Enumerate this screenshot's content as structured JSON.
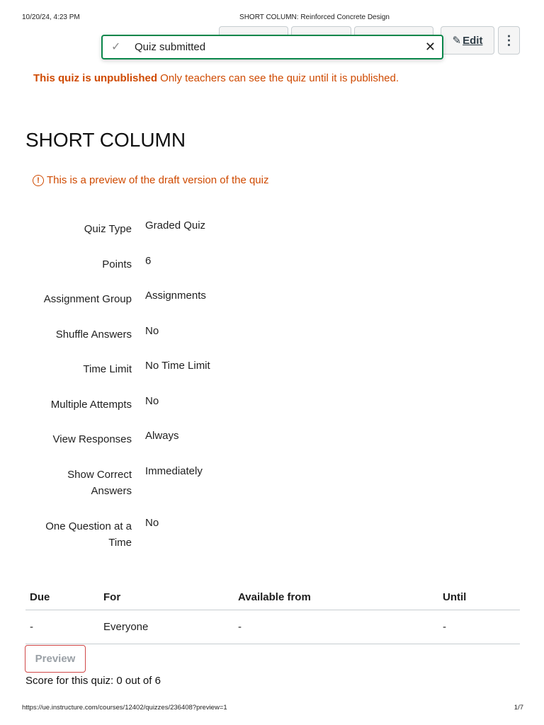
{
  "print_header": {
    "datetime": "10/20/24, 4:23 PM",
    "doc_title": "SHORT COLUMN: Reinforced Concrete Design"
  },
  "toolbar": {
    "edit_label": "Edit",
    "edit_icon": "pencil-icon",
    "more_icon": "kebab-icon"
  },
  "toast": {
    "message": "Quiz submitted",
    "icon": "check-icon",
    "close_icon": "close-icon",
    "border_color": "#0b874b"
  },
  "unpublished": {
    "bold": "This quiz is unpublished",
    "text": " Only teachers can see the quiz until it is published.",
    "color": "#cf4a00"
  },
  "quiz": {
    "title": "SHORT COLUMN",
    "draft_note": "This is a preview of the draft version of the quiz",
    "draft_icon": "warning-circle-icon"
  },
  "details": [
    {
      "label": "Quiz Type",
      "value": "Graded Quiz"
    },
    {
      "label": "Points",
      "value": "6"
    },
    {
      "label": "Assignment Group",
      "value": "Assignments"
    },
    {
      "label": "Shuffle Answers",
      "value": "No"
    },
    {
      "label": "Time Limit",
      "value": "No Time Limit"
    },
    {
      "label": "Multiple Attempts",
      "value": "No"
    },
    {
      "label": "View Responses",
      "value": "Always"
    },
    {
      "label": "Show Correct Answers",
      "value": "Immediately"
    },
    {
      "label": "One Question at a Time",
      "value": "No"
    }
  ],
  "availability": {
    "headers": [
      "Due",
      "For",
      "Available from",
      "Until"
    ],
    "row": [
      "-",
      "Everyone",
      "-",
      "-"
    ]
  },
  "preview_button": "Preview",
  "score_text": "Score for this quiz: 0 out of 6",
  "print_footer": {
    "url": "https://ue.instructure.com/courses/12402/quizzes/236408?preview=1",
    "page": "1/7"
  }
}
